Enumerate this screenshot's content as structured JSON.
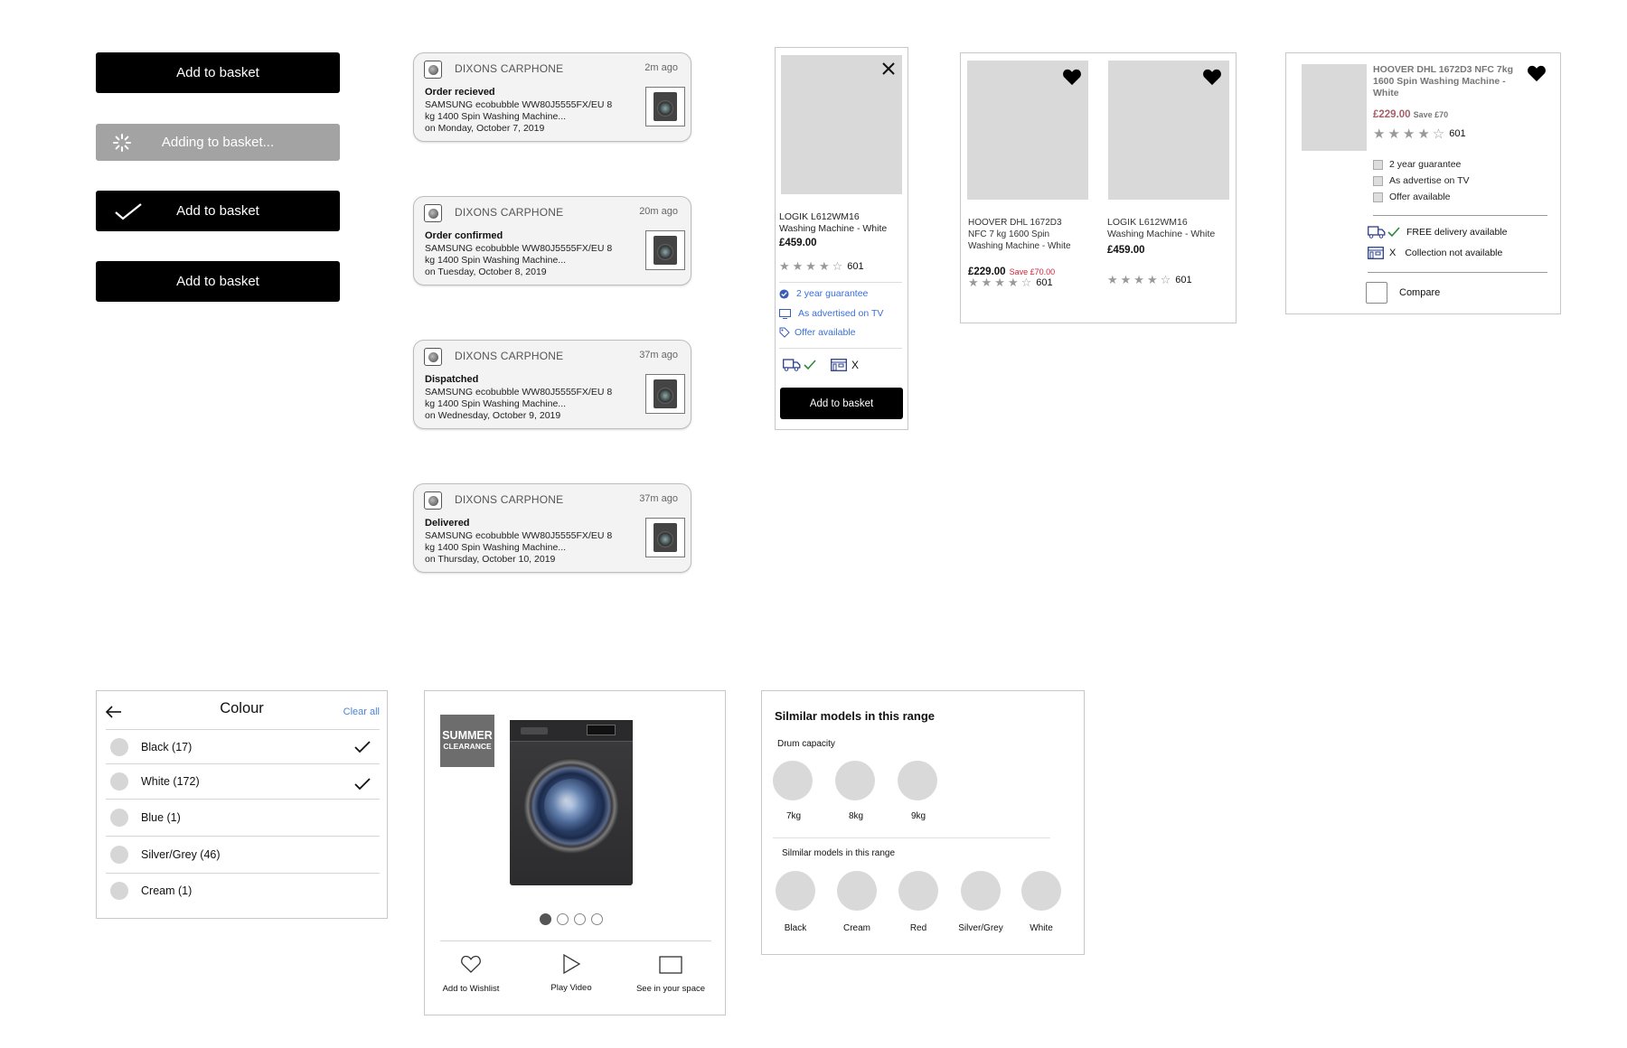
{
  "basket_buttons": {
    "default_label": "Add to basket",
    "loading_label": "Adding to basket...",
    "added_label": "Add to basket",
    "hover_label": "Add to basket"
  },
  "notifications": [
    {
      "brand": "DIXONS CARPHONE",
      "ago": "2m ago",
      "status": "Order recieved",
      "line1": "SAMSUNG ecobubble WW80J5555FX/EU 8",
      "line2": "kg 1400 Spin Washing Machine...",
      "line3": "on Monday, October 7, 2019"
    },
    {
      "brand": "DIXONS CARPHONE",
      "ago": "20m ago",
      "status": "Order confirmed",
      "line1": "SAMSUNG ecobubble WW80J5555FX/EU 8",
      "line2": "kg 1400 Spin Washing Machine...",
      "line3": "on Tuesday, October 8, 2019"
    },
    {
      "brand": "DIXONS CARPHONE",
      "ago": "37m ago",
      "status": "Dispatched",
      "line1": "SAMSUNG ecobubble WW80J5555FX/EU 8",
      "line2": "kg 1400 Spin Washing Machine...",
      "line3": "on Wednesday, October 9, 2019"
    },
    {
      "brand": "DIXONS CARPHONE",
      "ago": "37m ago",
      "status": "Delivered",
      "line1": "SAMSUNG ecobubble WW80J5555FX/EU 8",
      "line2": "kg 1400 Spin Washing Machine...",
      "line3": "on Thursday, October 10, 2019"
    }
  ],
  "product_card": {
    "title_line1": "LOGIK L612WM16",
    "title_line2": "Washing Machine - White",
    "price": "£459.00",
    "rating_count": "601",
    "guarantee": "2 year guarantee",
    "advertised": "As advertised on TV",
    "offer": "Offer available",
    "collection_mark": "X",
    "cta": "Add to basket"
  },
  "wishlist_cards": [
    {
      "title_line1": "HOOVER DHL 1672D3",
      "title_line2": "NFC 7 kg 1600 Spin",
      "title_line3": "Washing Machine - White",
      "price": "£229.00",
      "save": "Save £70.00",
      "rating_count": "601"
    },
    {
      "title_line1": "LOGIK L612WM16",
      "title_line2": "Washing Machine - White",
      "title_line3": "",
      "price": "£459.00",
      "save": "",
      "rating_count": "601"
    }
  ],
  "compare_card": {
    "title_line1": "HOOVER DHL 1672D3 NFC 7kg",
    "title_line2": "1600 Spin Washing Machine -",
    "title_line3": "White",
    "price": "£229.00",
    "save": "Save £70",
    "rating_count": "601",
    "features": [
      "2 year guarantee",
      "As advertise on TV",
      "Offer available"
    ],
    "delivery": "FREE delivery available",
    "collection_mark": "X",
    "collection": "Collection not available",
    "compare": "Compare"
  },
  "colour_filter": {
    "title": "Colour",
    "clear": "Clear all",
    "options": [
      {
        "label": "Black (17)",
        "checked": true
      },
      {
        "label": "White (172)",
        "checked": true
      },
      {
        "label": "Blue (1)",
        "checked": false
      },
      {
        "label": "Silver/Grey (46)",
        "checked": false
      },
      {
        "label": "Cream (1)",
        "checked": false
      }
    ]
  },
  "gallery": {
    "badge_line1": "SUMMER",
    "badge_line2": "CLEARANCE",
    "actions": [
      "Add to Wishlist",
      "Play Video",
      "See in your space"
    ]
  },
  "similar": {
    "title": "Silmilar models in this range",
    "drum_label": "Drum capacity",
    "drum_options": [
      "7kg",
      "8kg",
      "9kg"
    ],
    "colour_label": "Silmilar models in this range",
    "colour_options": [
      "Black",
      "Cream",
      "Red",
      "Silver/Grey",
      "White"
    ]
  }
}
